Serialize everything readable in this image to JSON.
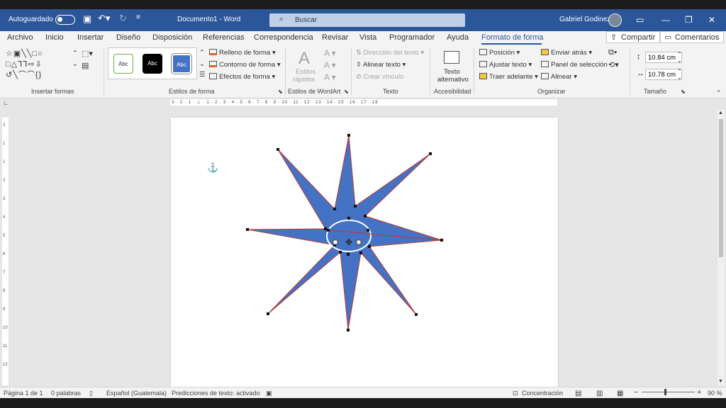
{
  "titlebar": {
    "autosave_label": "Autoguardado",
    "document_title": "Documento1  -  Word",
    "search_label": "Buscar",
    "user_name": "Gabriel Godinez",
    "controls": {
      "minimize": "—",
      "restore": "❐",
      "close": "✕"
    },
    "accent": "#2b579a"
  },
  "tabs": [
    "Archivo",
    "Inicio",
    "Insertar",
    "Diseño",
    "Disposición",
    "Referencias",
    "Correspondencia",
    "Revisar",
    "Vista",
    "Programador",
    "Ayuda",
    "Formato de forma"
  ],
  "active_tab": "Formato de forma",
  "share_label": "Compartir",
  "comments_label": "Comentarios",
  "ribbon": {
    "insert_shapes": {
      "group": "Insertar formas",
      "shape_rows": [
        "☆▣╲╲□○",
        "□△⅂⅂⇨⇩",
        "↺╲⌒⌒{}"
      ]
    },
    "shape_styles": {
      "group": "Estilos de forma",
      "previews": [
        "Abc",
        "Abc",
        "Abc"
      ],
      "fill": "Relleno de forma",
      "outline": "Contorno de forma",
      "effects": "Efectos de forma",
      "fill_color": "#4472c4"
    },
    "wordart": {
      "group": "Estilos de WordArt",
      "quick_styles_1": "Estilos",
      "quick_styles_2": "rápidos"
    },
    "text": {
      "group": "Texto",
      "direction": "Dirección del texto",
      "align": "Alinear texto",
      "link": "Crear vínculo"
    },
    "accessibility": {
      "group": "Accesibilidad",
      "alt_text_1": "Texto",
      "alt_text_2": "alternativo"
    },
    "arrange": {
      "group": "Organizar",
      "position": "Posición",
      "wrap": "Ajustar texto",
      "forward": "Traer adelante",
      "backward": "Enviar atrás",
      "selection": "Panel de selección",
      "align": "Alinear"
    },
    "size": {
      "group": "Tamaño",
      "height": "10.84 cm",
      "width": "10.78 cm"
    }
  },
  "ruler_text": "3 · 2 · 1 · ⊥ · 1 · 2 · 3 · 4 · 5 · 6 · 7 · 8 · 9 · 10 · 11 · 12 · 13 · 14 · 15 · 16 · 17 · 18",
  "vruler_labels": [
    "2",
    "1",
    "1",
    "2",
    "3",
    "4",
    "5",
    "6",
    "7",
    "8",
    "9",
    "10",
    "11",
    "12"
  ],
  "shape": {
    "type": "8-point star",
    "fill": "#4472c4",
    "outline": "#c0392b"
  },
  "status": {
    "page": "Página 1 de 1",
    "words": "0 palabras",
    "language": "Español (Guatemala)",
    "predictions": "Predicciones de texto: activado",
    "focus": "Concentración",
    "zoom": "90 %",
    "zoom_level_percent": 90
  }
}
